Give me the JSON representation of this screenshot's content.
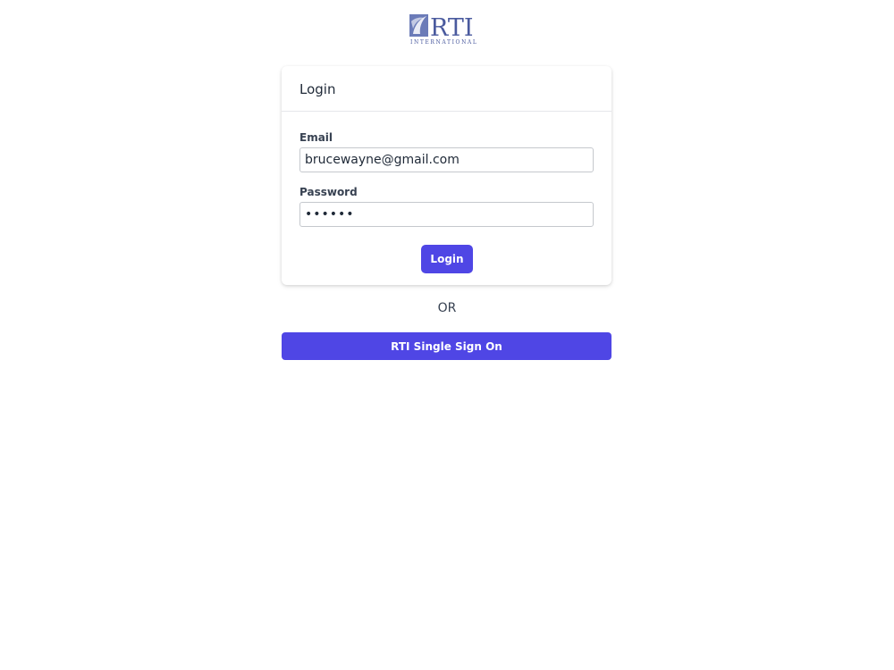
{
  "logo": {
    "brand": "RTI",
    "subtitle": "INTERNATIONAL"
  },
  "login_card": {
    "title": "Login",
    "email": {
      "label": "Email",
      "value": "brucewayne@gmail.com"
    },
    "password": {
      "label": "Password",
      "value": "••••••"
    },
    "login_button_label": "Login"
  },
  "divider_text": "OR",
  "sso_button_label": "RTI Single Sign On",
  "colors": {
    "accent": "#4f46e5",
    "logo_blue": "#5a6aa8"
  }
}
